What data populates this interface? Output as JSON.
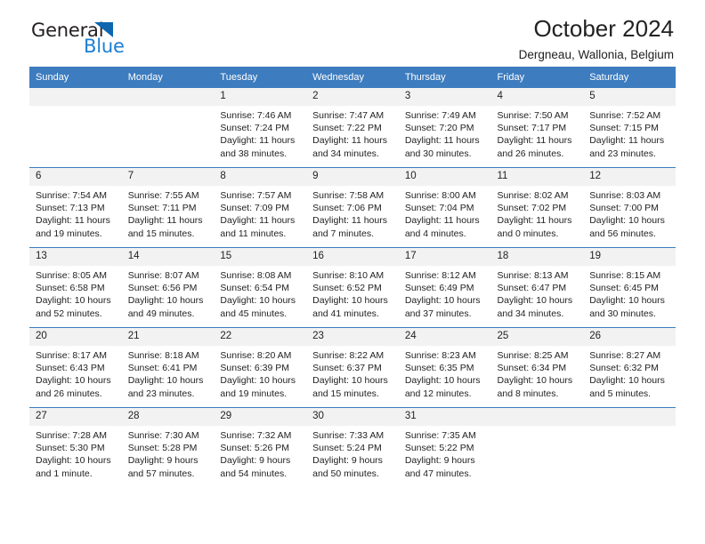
{
  "brand": {
    "name_top": "General",
    "name_bottom": "Blue",
    "color_dark": "#231f20",
    "color_blue": "#1b7fd4",
    "triangle_color": "#0c67b0"
  },
  "header": {
    "title": "October 2024",
    "subtitle": "Dergneau, Wallonia, Belgium"
  },
  "theme": {
    "header_bg": "#3d7cbf",
    "header_text": "#ffffff",
    "daynum_bg": "#f2f2f2",
    "cell_bg": "#ffffff",
    "row_border": "#3d7cbf"
  },
  "weekdays": [
    "Sunday",
    "Monday",
    "Tuesday",
    "Wednesday",
    "Thursday",
    "Friday",
    "Saturday"
  ],
  "weeks": [
    [
      {
        "day": "",
        "lines": []
      },
      {
        "day": "",
        "lines": []
      },
      {
        "day": "1",
        "lines": [
          "Sunrise: 7:46 AM",
          "Sunset: 7:24 PM",
          "Daylight: 11 hours",
          "and 38 minutes."
        ]
      },
      {
        "day": "2",
        "lines": [
          "Sunrise: 7:47 AM",
          "Sunset: 7:22 PM",
          "Daylight: 11 hours",
          "and 34 minutes."
        ]
      },
      {
        "day": "3",
        "lines": [
          "Sunrise: 7:49 AM",
          "Sunset: 7:20 PM",
          "Daylight: 11 hours",
          "and 30 minutes."
        ]
      },
      {
        "day": "4",
        "lines": [
          "Sunrise: 7:50 AM",
          "Sunset: 7:17 PM",
          "Daylight: 11 hours",
          "and 26 minutes."
        ]
      },
      {
        "day": "5",
        "lines": [
          "Sunrise: 7:52 AM",
          "Sunset: 7:15 PM",
          "Daylight: 11 hours",
          "and 23 minutes."
        ]
      }
    ],
    [
      {
        "day": "6",
        "lines": [
          "Sunrise: 7:54 AM",
          "Sunset: 7:13 PM",
          "Daylight: 11 hours",
          "and 19 minutes."
        ]
      },
      {
        "day": "7",
        "lines": [
          "Sunrise: 7:55 AM",
          "Sunset: 7:11 PM",
          "Daylight: 11 hours",
          "and 15 minutes."
        ]
      },
      {
        "day": "8",
        "lines": [
          "Sunrise: 7:57 AM",
          "Sunset: 7:09 PM",
          "Daylight: 11 hours",
          "and 11 minutes."
        ]
      },
      {
        "day": "9",
        "lines": [
          "Sunrise: 7:58 AM",
          "Sunset: 7:06 PM",
          "Daylight: 11 hours",
          "and 7 minutes."
        ]
      },
      {
        "day": "10",
        "lines": [
          "Sunrise: 8:00 AM",
          "Sunset: 7:04 PM",
          "Daylight: 11 hours",
          "and 4 minutes."
        ]
      },
      {
        "day": "11",
        "lines": [
          "Sunrise: 8:02 AM",
          "Sunset: 7:02 PM",
          "Daylight: 11 hours",
          "and 0 minutes."
        ]
      },
      {
        "day": "12",
        "lines": [
          "Sunrise: 8:03 AM",
          "Sunset: 7:00 PM",
          "Daylight: 10 hours",
          "and 56 minutes."
        ]
      }
    ],
    [
      {
        "day": "13",
        "lines": [
          "Sunrise: 8:05 AM",
          "Sunset: 6:58 PM",
          "Daylight: 10 hours",
          "and 52 minutes."
        ]
      },
      {
        "day": "14",
        "lines": [
          "Sunrise: 8:07 AM",
          "Sunset: 6:56 PM",
          "Daylight: 10 hours",
          "and 49 minutes."
        ]
      },
      {
        "day": "15",
        "lines": [
          "Sunrise: 8:08 AM",
          "Sunset: 6:54 PM",
          "Daylight: 10 hours",
          "and 45 minutes."
        ]
      },
      {
        "day": "16",
        "lines": [
          "Sunrise: 8:10 AM",
          "Sunset: 6:52 PM",
          "Daylight: 10 hours",
          "and 41 minutes."
        ]
      },
      {
        "day": "17",
        "lines": [
          "Sunrise: 8:12 AM",
          "Sunset: 6:49 PM",
          "Daylight: 10 hours",
          "and 37 minutes."
        ]
      },
      {
        "day": "18",
        "lines": [
          "Sunrise: 8:13 AM",
          "Sunset: 6:47 PM",
          "Daylight: 10 hours",
          "and 34 minutes."
        ]
      },
      {
        "day": "19",
        "lines": [
          "Sunrise: 8:15 AM",
          "Sunset: 6:45 PM",
          "Daylight: 10 hours",
          "and 30 minutes."
        ]
      }
    ],
    [
      {
        "day": "20",
        "lines": [
          "Sunrise: 8:17 AM",
          "Sunset: 6:43 PM",
          "Daylight: 10 hours",
          "and 26 minutes."
        ]
      },
      {
        "day": "21",
        "lines": [
          "Sunrise: 8:18 AM",
          "Sunset: 6:41 PM",
          "Daylight: 10 hours",
          "and 23 minutes."
        ]
      },
      {
        "day": "22",
        "lines": [
          "Sunrise: 8:20 AM",
          "Sunset: 6:39 PM",
          "Daylight: 10 hours",
          "and 19 minutes."
        ]
      },
      {
        "day": "23",
        "lines": [
          "Sunrise: 8:22 AM",
          "Sunset: 6:37 PM",
          "Daylight: 10 hours",
          "and 15 minutes."
        ]
      },
      {
        "day": "24",
        "lines": [
          "Sunrise: 8:23 AM",
          "Sunset: 6:35 PM",
          "Daylight: 10 hours",
          "and 12 minutes."
        ]
      },
      {
        "day": "25",
        "lines": [
          "Sunrise: 8:25 AM",
          "Sunset: 6:34 PM",
          "Daylight: 10 hours",
          "and 8 minutes."
        ]
      },
      {
        "day": "26",
        "lines": [
          "Sunrise: 8:27 AM",
          "Sunset: 6:32 PM",
          "Daylight: 10 hours",
          "and 5 minutes."
        ]
      }
    ],
    [
      {
        "day": "27",
        "lines": [
          "Sunrise: 7:28 AM",
          "Sunset: 5:30 PM",
          "Daylight: 10 hours",
          "and 1 minute."
        ]
      },
      {
        "day": "28",
        "lines": [
          "Sunrise: 7:30 AM",
          "Sunset: 5:28 PM",
          "Daylight: 9 hours",
          "and 57 minutes."
        ]
      },
      {
        "day": "29",
        "lines": [
          "Sunrise: 7:32 AM",
          "Sunset: 5:26 PM",
          "Daylight: 9 hours",
          "and 54 minutes."
        ]
      },
      {
        "day": "30",
        "lines": [
          "Sunrise: 7:33 AM",
          "Sunset: 5:24 PM",
          "Daylight: 9 hours",
          "and 50 minutes."
        ]
      },
      {
        "day": "31",
        "lines": [
          "Sunrise: 7:35 AM",
          "Sunset: 5:22 PM",
          "Daylight: 9 hours",
          "and 47 minutes."
        ]
      },
      {
        "day": "",
        "lines": []
      },
      {
        "day": "",
        "lines": []
      }
    ]
  ]
}
